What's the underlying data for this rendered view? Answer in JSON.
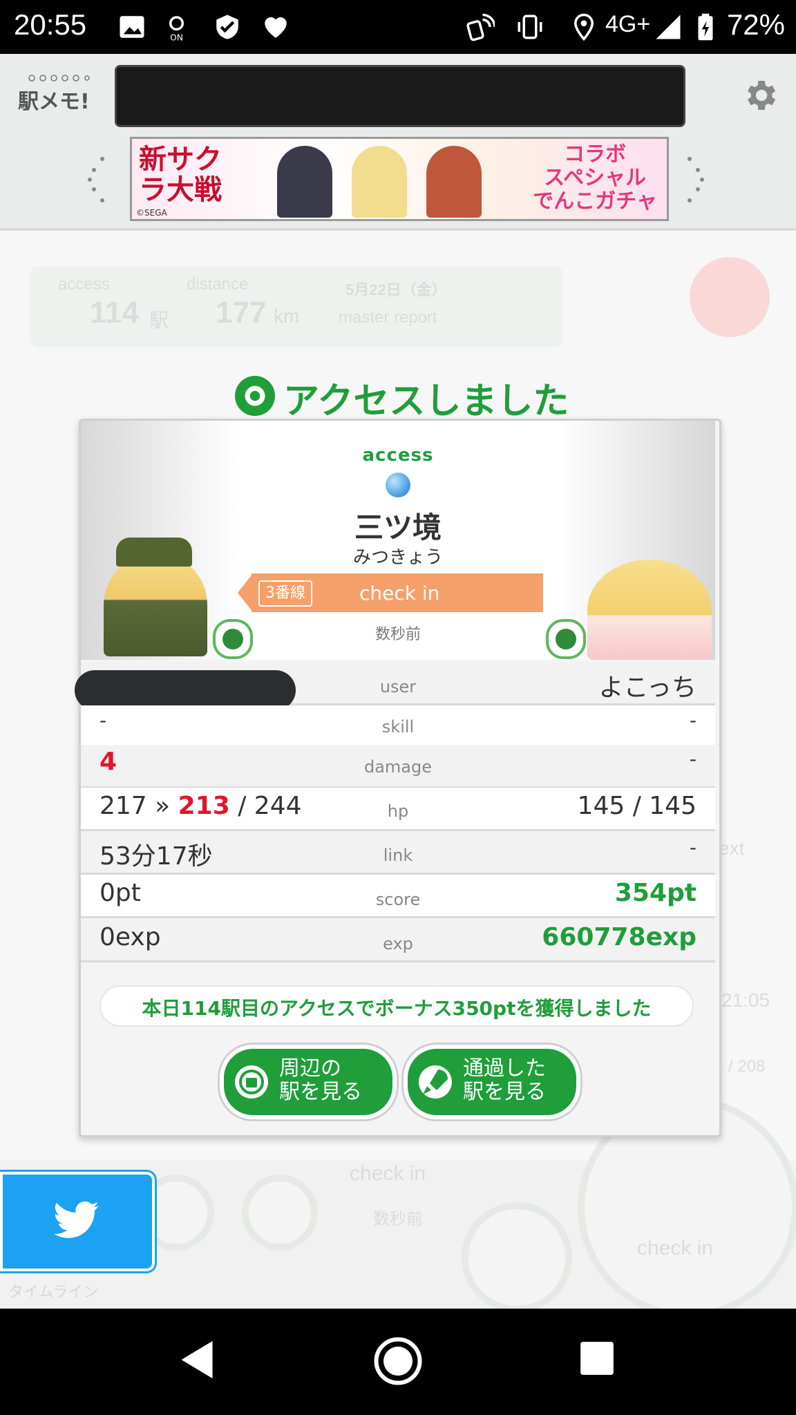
{
  "status_bar": {
    "time": "20:55",
    "network": "4G+",
    "battery": "72%",
    "icons": [
      "image-icon",
      "location-on-icon",
      "shield-check-icon",
      "heart-icon",
      "nfc-icon",
      "vibrate-icon",
      "location-pin-icon",
      "signal-icon",
      "battery-icon"
    ]
  },
  "header": {
    "logo_text": "駅メモ!",
    "banner": {
      "left_text": "新サクラ大戦",
      "right_text": "コラボ\nスペシャル\nでんこガチャ",
      "copyright": "©SEGA"
    }
  },
  "background": {
    "stats_access_label": "access",
    "stats_access_value": "114",
    "stats_access_unit": "駅",
    "stats_distance_label": "distance",
    "stats_distance_value": "177",
    "stats_distance_unit": "km",
    "stats_date": "5月22日（金）",
    "stats_report": "master report",
    "checkin_label": "check in",
    "next_label": "ext",
    "time_right": "21:05",
    "count_right": "/ 208",
    "checkin_bottom": "check in",
    "ago_bottom": "数秒前",
    "timeline_label": "タイムライン"
  },
  "result": {
    "title": "アクセスしました",
    "access_label": "access",
    "station_name": "三ツ境",
    "station_kana": "みつきょう",
    "line_tag": "3番線",
    "checkin_label": "check in",
    "ago": "数秒前",
    "rows": {
      "user": {
        "label": "user",
        "right": "よこっち"
      },
      "skill": {
        "label": "skill",
        "left": "-",
        "right": "-"
      },
      "damage": {
        "label": "damage",
        "left": "4",
        "right": "-"
      },
      "hp": {
        "label": "hp",
        "left_before": "217 » ",
        "left_now": "213",
        "left_max": " / 244",
        "right": "145 / 145"
      },
      "link": {
        "label": "link",
        "left": "53分17秒",
        "right": "-"
      },
      "score": {
        "label": "score",
        "left": "0pt",
        "right": "354pt"
      },
      "exp": {
        "label": "exp",
        "left": "0exp",
        "right": "660778exp"
      }
    },
    "bonus": "本日114駅目のアクセスでボーナス350ptを獲得しました",
    "buttons": {
      "nearby": "周辺の\n駅を見る",
      "passed": "通過した\n駅を見る"
    }
  },
  "colors": {
    "brand_green": "#1f9e3a",
    "accent_orange": "#f5a06a",
    "damage_red": "#e0162b",
    "twitter_blue": "#1da1f2"
  }
}
